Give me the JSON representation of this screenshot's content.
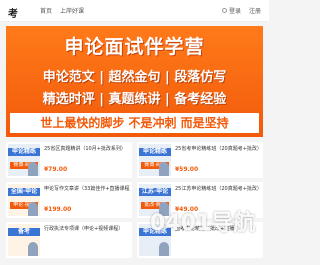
{
  "header": {
    "logo": "考",
    "nav": [
      "首页",
      "上岸好课"
    ],
    "right_links": [
      "登录",
      "注册"
    ]
  },
  "banner": {
    "title": "申论面试伴学营",
    "line1": "申论范文 | 超然金句 | 段落仿写",
    "line2": "精选时评 | 真题练讲 | 备考经验",
    "slogan": "世上最快的脚步 不是冲刺 而是坚持"
  },
  "cards": [
    {
      "tag": "申论精练",
      "tag2": "赛博·阅卷",
      "title": "25省区真题精讲（10月+批改系列）",
      "meta": "",
      "price": "¥79.00"
    },
    {
      "tag": "申论精练",
      "tag2": "赛博·阅卷",
      "title": "25省考申论精练班（20真题考+批改）",
      "meta": "",
      "price": "¥59.00"
    },
    {
      "tag": "全国·申论",
      "tag2": "申论·视频",
      "title": "申论写作文章讲（33篇佳作+直播课程）",
      "meta": "",
      "price": "¥199.00"
    },
    {
      "tag": "江苏·申论",
      "tag2": "批改·赛博",
      "title": "25江苏申论精练班（20真题考+批改）",
      "meta": "",
      "price": "¥49.00"
    },
    {
      "tag": "备考",
      "tag2": "",
      "title": "行政执法专项课（申论+视频课程）",
      "meta": "",
      "price": ""
    },
    {
      "tag": "申论精练",
      "tag2": "",
      "title": "国考申论精练（批改+直播）",
      "meta": "",
      "price": ""
    }
  ],
  "watermark": "0401导航"
}
